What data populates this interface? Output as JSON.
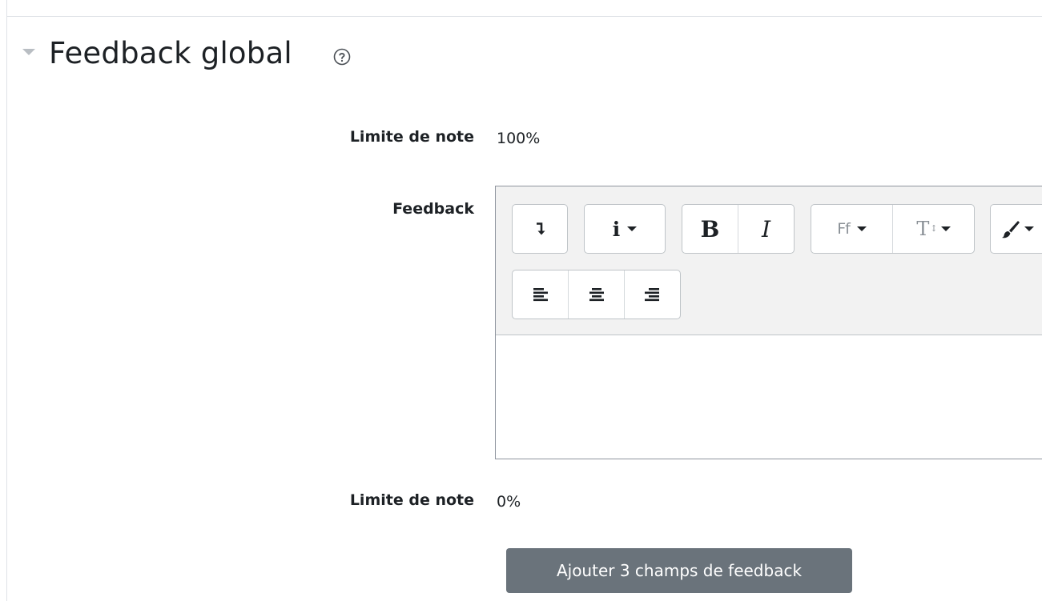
{
  "section": {
    "title": "Feedback global",
    "help_icon": "question-circle-icon"
  },
  "fields": {
    "grade_limit_label": "Limite de note",
    "grade_top_value": "100%",
    "feedback_label": "Feedback",
    "grade_limit_label_2": "Limite de note",
    "grade_bottom_value": "0%"
  },
  "editor": {
    "toolbar_row1": {
      "show_more_glyph": "↴",
      "info_glyph": "i",
      "bold_glyph": "B",
      "italic_glyph": "I",
      "font_family_glyph": "Ff",
      "font_size_glyph": "T"
    },
    "icons": [
      "show-more-icon",
      "info-icon",
      "bold-icon",
      "italic-icon",
      "font-family-icon",
      "font-size-icon",
      "brush-icon",
      "align-left-icon",
      "align-center-icon",
      "align-right-icon"
    ],
    "content": ""
  },
  "actions": {
    "add_feedback_button": "Ajouter 3 champs de feedback"
  },
  "colors": {
    "button_bg": "#6a737b",
    "border": "#dee2e6",
    "toolbar_bg": "#f2f2f2"
  }
}
